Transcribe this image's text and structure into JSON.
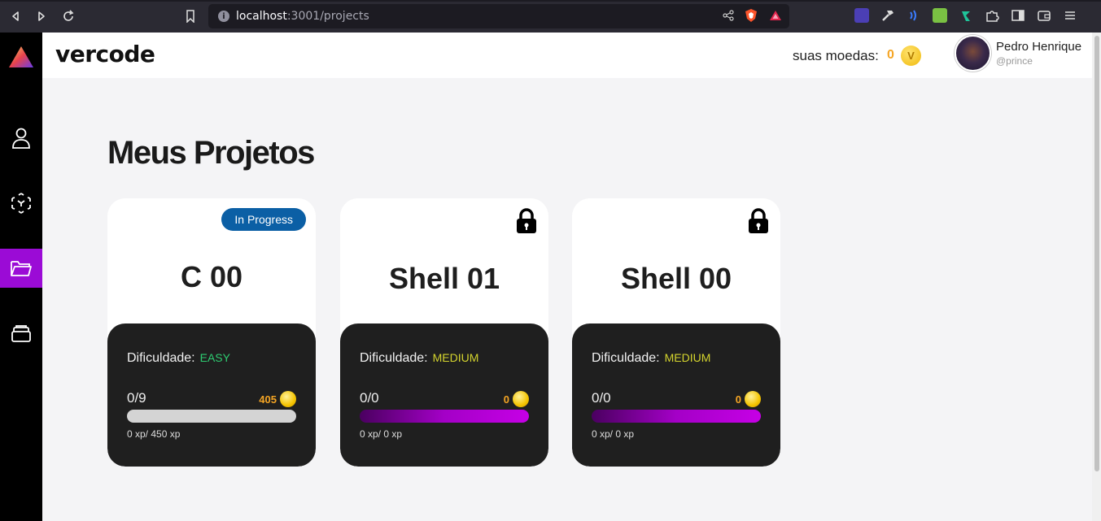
{
  "browser": {
    "url_host": "localhost",
    "url_path": ":3001/projects"
  },
  "header": {
    "brand": "vercode",
    "coins_label": "suas moedas:",
    "coins_value": "0",
    "coin_symbol": "V",
    "user_name": "Pedro Henrique",
    "user_handle": "@prince"
  },
  "sidebar": {
    "items": [
      {
        "icon": "user-icon",
        "active": false
      },
      {
        "icon": "cube-icon",
        "active": false
      },
      {
        "icon": "folder-icon",
        "active": true
      },
      {
        "icon": "layers-icon",
        "active": false
      }
    ]
  },
  "main": {
    "title": "Meus Projetos",
    "projects": [
      {
        "name": "C 00",
        "status": "In Progress",
        "locked": false,
        "difficulty_label": "Dificuldade:",
        "difficulty": "EASY",
        "count": "0/9",
        "reward": "405",
        "xp": "0 xp/ 450 xp"
      },
      {
        "name": "Shell 01",
        "status": "",
        "locked": true,
        "difficulty_label": "Dificuldade:",
        "difficulty": "MEDIUM",
        "count": "0/0",
        "reward": "0",
        "xp": "0 xp/ 0 xp"
      },
      {
        "name": "Shell 00",
        "status": "",
        "locked": true,
        "difficulty_label": "Dificuldade:",
        "difficulty": "MEDIUM",
        "count": "0/0",
        "reward": "0",
        "xp": "0 xp/ 0 xp"
      }
    ]
  },
  "colors": {
    "accent": "#9b0bd6",
    "badge": "#0b5fa5",
    "easy": "#2ecc71",
    "medium": "#d4d42e",
    "coin": "#f5a524"
  }
}
